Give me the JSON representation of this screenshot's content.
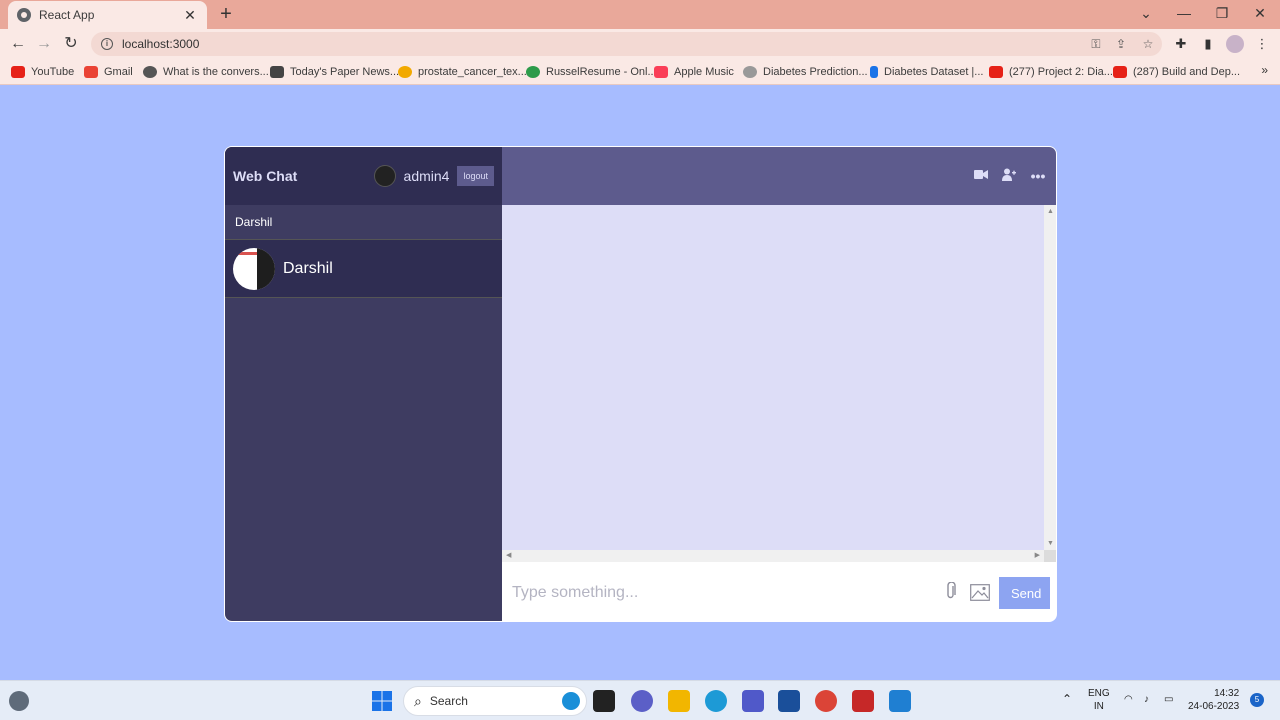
{
  "browser": {
    "tab_title": "React App",
    "url": "localhost:3000",
    "bookmarks": [
      {
        "label": "YouTube",
        "color": "#e62117"
      },
      {
        "label": "Gmail",
        "color": "#ea4335"
      },
      {
        "label": "What is the convers...",
        "color": "#555555"
      },
      {
        "label": "Today's Paper News...",
        "color": "#444444"
      },
      {
        "label": "prostate_cancer_tex...",
        "color": "#f2a900"
      },
      {
        "label": "RusselResume - Onl...",
        "color": "#2d9b4a"
      },
      {
        "label": "Apple Music",
        "color": "#fa3e57"
      },
      {
        "label": "Diabetes Prediction...",
        "color": "#777777"
      },
      {
        "label": "Diabetes Dataset |...",
        "color": "#1a73e8"
      },
      {
        "label": "(277) Project 2: Dia...",
        "color": "#e62117"
      },
      {
        "label": "(287) Build and Dep...",
        "color": "#e62117"
      }
    ]
  },
  "app": {
    "logo": "Web Chat",
    "current_user": "admin4",
    "logout_label": "logout",
    "search_value": "Darshil",
    "chats": [
      {
        "name": "Darshil"
      }
    ],
    "input_placeholder": "Type something...",
    "send_label": "Send",
    "colors": {
      "nav": "#2f2d52",
      "sidebar": "#3e3c61",
      "chat_header": "#5d5b8d",
      "messages_bg": "#ddddf7",
      "send_button": "#8da4f1",
      "page_bg": "#a7bcff"
    }
  },
  "taskbar": {
    "search_label": "Search",
    "lang": "ENG",
    "region": "IN",
    "time": "14:32",
    "date": "24-06-2023",
    "notification_count": "5"
  }
}
